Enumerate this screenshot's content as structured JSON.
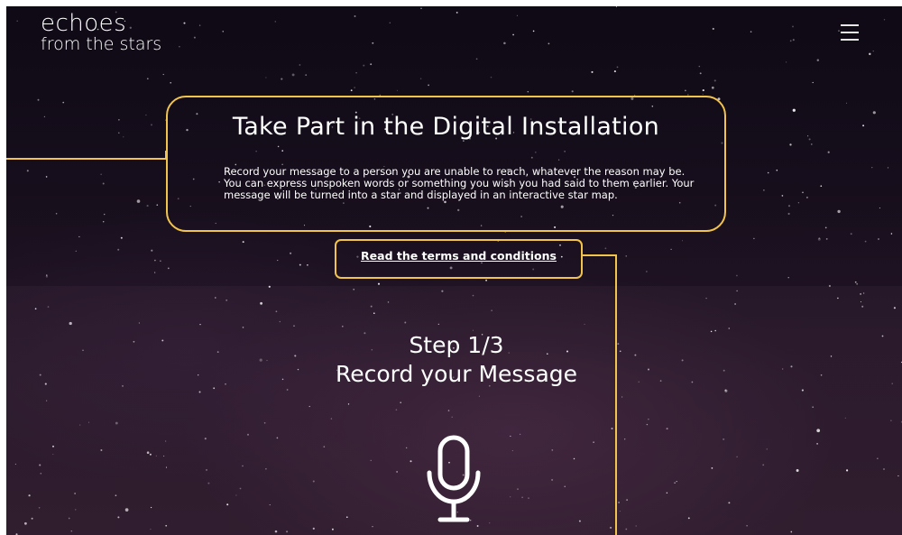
{
  "logo": {
    "line1": "echoes",
    "line2": "from the stars"
  },
  "header": {
    "menu_icon": "hamburger-menu-icon"
  },
  "intro": {
    "title": "Take Part in the Digital Installation",
    "body": "Record your message to a person you are unable to reach, whatever the reason may be. You can express unspoken words or something you wish you had said to them earlier. Your message will be turned into a star and displayed in an interactive star map."
  },
  "terms": {
    "link_text": "Read the terms and conditions"
  },
  "step": {
    "number": "Step 1/3",
    "title": "Record your Message",
    "record_icon": "microphone-icon"
  },
  "colors": {
    "accent": "#f2c44b",
    "background": "#1c1221",
    "text": "#ffffff"
  }
}
